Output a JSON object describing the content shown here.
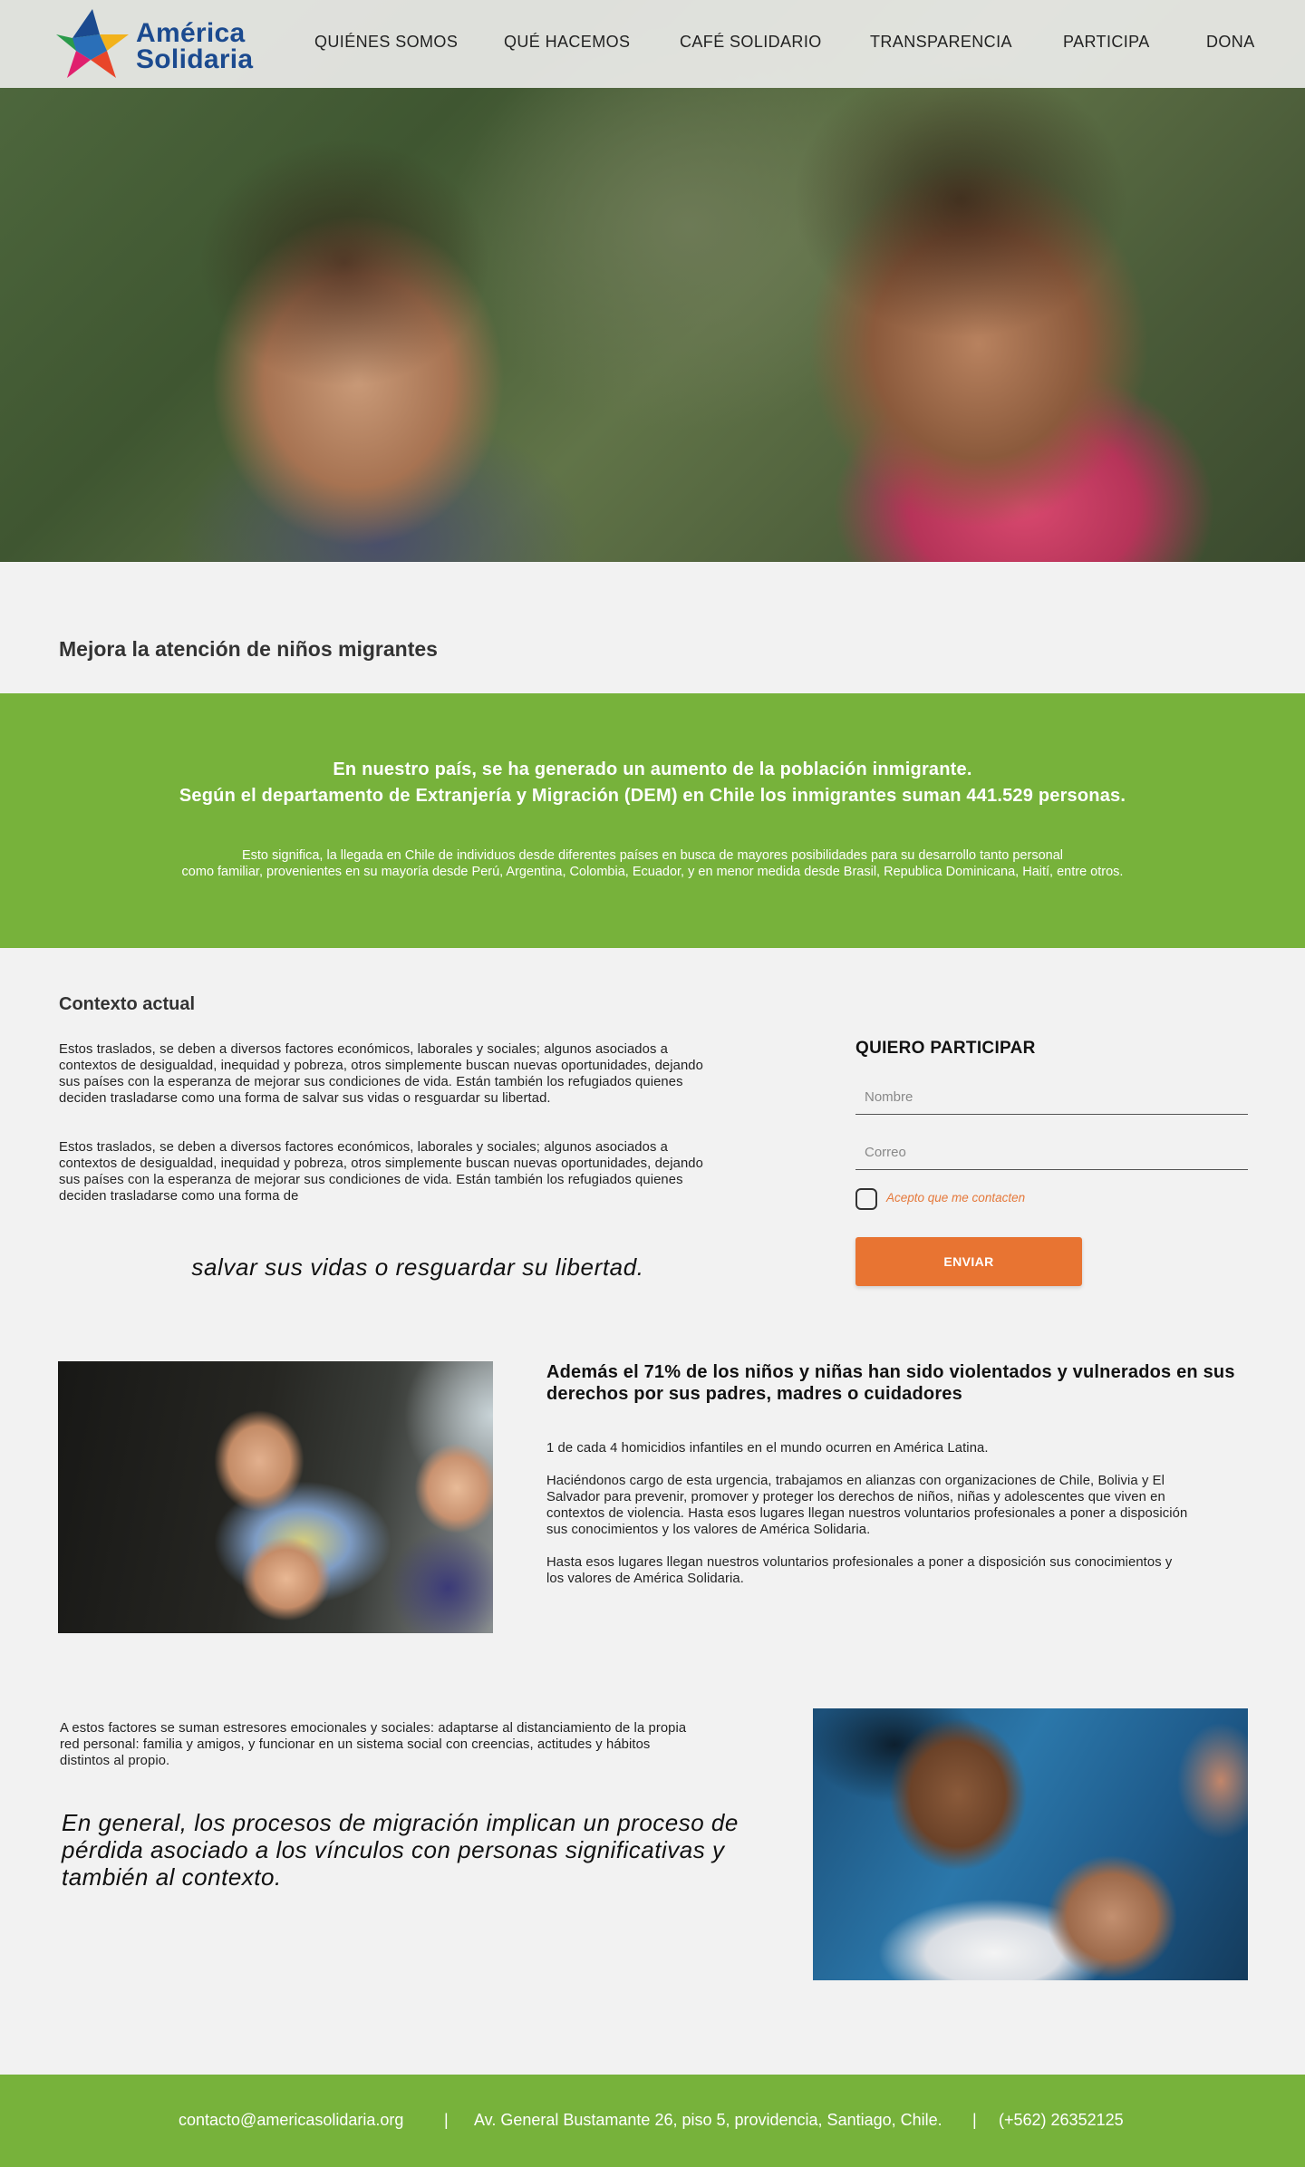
{
  "brand": {
    "line1": "América",
    "line2": "Solidaria"
  },
  "nav": [
    {
      "label": "QUIÉNES SOMOS"
    },
    {
      "label": "QUÉ HACEMOS"
    },
    {
      "label": "CAFÉ SOLIDARIO"
    },
    {
      "label": "TRANSPARENCIA"
    },
    {
      "label": "PARTICIPA"
    },
    {
      "label": "DONA"
    }
  ],
  "page_title": "Mejora la atención de niños migrantes",
  "highlight": {
    "lead1": "En nuestro país, se ha generado un aumento de la población inmigrante.",
    "lead2": "Según el departamento de Extranjería y Migración (DEM) en Chile los inmigrantes suman 441.529 personas.",
    "small1": "Esto significa, la llegada en Chile de individuos desde diferentes países en busca de mayores posibilidades para su desarrollo tanto personal",
    "small2": "como familiar,  provenientes en su mayoría desde Perú, Argentina, Colombia, Ecuador, y en menor medida desde Brasil, Republica Dominicana, Haití, entre otros."
  },
  "context": {
    "title": "Contexto actual",
    "p1": [
      "Estos traslados,  se deben a diversos factores económicos, laborales y sociales; algunos asociados  a",
      "contextos  de  desigualdad, inequidad y pobreza, otros simplemente  buscan nuevas oportunidades, dejando",
      "sus países con la esperanza de mejorar sus condiciones de vida. Están  también los refugiados quienes",
      "deciden trasladarse como una forma de salvar sus vidas o resguardar su libertad."
    ],
    "p2": [
      "Estos traslados,  se deben a diversos factores económicos, laborales y sociales; algunos asociados  a",
      "contextos  de  desigualdad, inequidad y pobreza, otros simplemente  buscan nuevas oportunidades, dejando",
      "sus países con la esperanza de mejorar sus condiciones de vida. Están  también los refugiados quienes",
      "deciden trasladarse como una forma de"
    ],
    "quote": "salvar sus vidas o resguardar su libertad."
  },
  "form": {
    "title": "QUIERO PARTICIPAR",
    "name_placeholder": "Nombre",
    "email_placeholder": "Correo",
    "consent_label": "Acepto que me contacten",
    "submit_label": "ENVIAR"
  },
  "violence": {
    "title_line1": "Además el 71% de los niños y niñas han sido violentados y vulnerados en sus",
    "title_line2": "derechos por sus padres, madres o cuidadores",
    "p1": "1 de cada 4 homicidios infantiles en el mundo ocurren en América Latina.",
    "p2": [
      "Haciéndonos cargo de esta urgencia, trabajamos en alianzas con organizaciones de Chile, Bolivia y El",
      "Salvador para prevenir, promover y proteger los derechos de niños, niñas y adolescentes que viven en",
      "contextos de violencia. Hasta esos lugares llegan nuestros voluntarios profesionales a poner a disposición",
      "sus conocimientos y los valores de América Solidaria."
    ],
    "p3": [
      "Hasta esos lugares llegan nuestros voluntarios profesionales a poner a disposición sus conocimientos y",
      "los valores de América Solidaria."
    ]
  },
  "migration": {
    "p1": [
      "A estos factores se suman estresores emocionales y sociales: adaptarse al distanciamiento de la propia",
      "red personal: familia y amigos, y funcionar en un sistema social con creencias, actitudes y hábitos",
      "distintos al propio."
    ],
    "quote": [
      "En general, los procesos de migración implican un proceso de",
      "pérdida asociado a los vínculos con personas significativas y",
      "también al contexto."
    ]
  },
  "footer": {
    "email": "contacto@americasolidaria.org",
    "sep": "|",
    "address": "Av. General Bustamante 26, piso 5, providencia, Santiago, Chile.",
    "phone": "(+562) 26352125"
  },
  "colors": {
    "green": "#77b23b",
    "orange": "#e87432",
    "brand_blue": "#1b4a8f",
    "background": "#f2f2f2"
  }
}
